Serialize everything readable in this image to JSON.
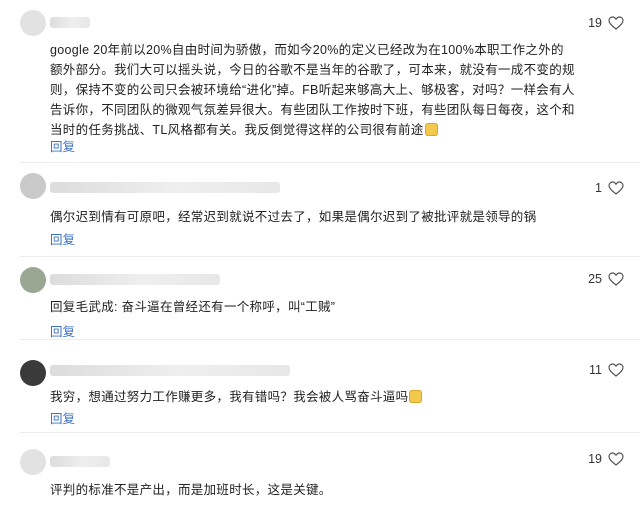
{
  "comments": [
    {
      "likes": "19",
      "text": "google 20年前以20%自由时间为骄傲，而如今20%的定义已经改为在100%本职工作之外的额外部分。我们大可以摇头说，今日的谷歌不是当年的谷歌了，可本来，就没有一成不变的规则，保持不变的公司只会被环境给“进化”掉。FB听起来够高大上、够极客，对吗？一样会有人告诉你，不同团队的微观气氛差异很大。有些团队工作按时下班，有些团队每日每夜，这个和当时的任务挑战、TL风格都有关。我反倒觉得这样的公司很有前途",
      "reply": "回复",
      "emoji": "smile-emoji"
    },
    {
      "likes": "1",
      "text": "偶尔迟到情有可原吧，经常迟到就说不过去了，如果是偶尔迟到了被批评就是领导的锅",
      "reply": "回复"
    },
    {
      "likes": "25",
      "text": "回复毛武成: 奋斗逼在曾经还有一个称呼，叫“工贼”",
      "reply": "回复"
    },
    {
      "likes": "11",
      "text": "我穷，想通过努力工作赚更多，我有错吗？我会被人骂奋斗逼吗",
      "reply": "回复",
      "emoji": "laugh-emoji"
    },
    {
      "likes": "19",
      "text": "评判的标准不是产出，而是加班时长，这是关键。",
      "reply": "回复"
    }
  ],
  "icons": {
    "like": "heart-outline-icon"
  },
  "colors": {
    "reply": "#3d6fc2",
    "divider": "#ececec"
  }
}
